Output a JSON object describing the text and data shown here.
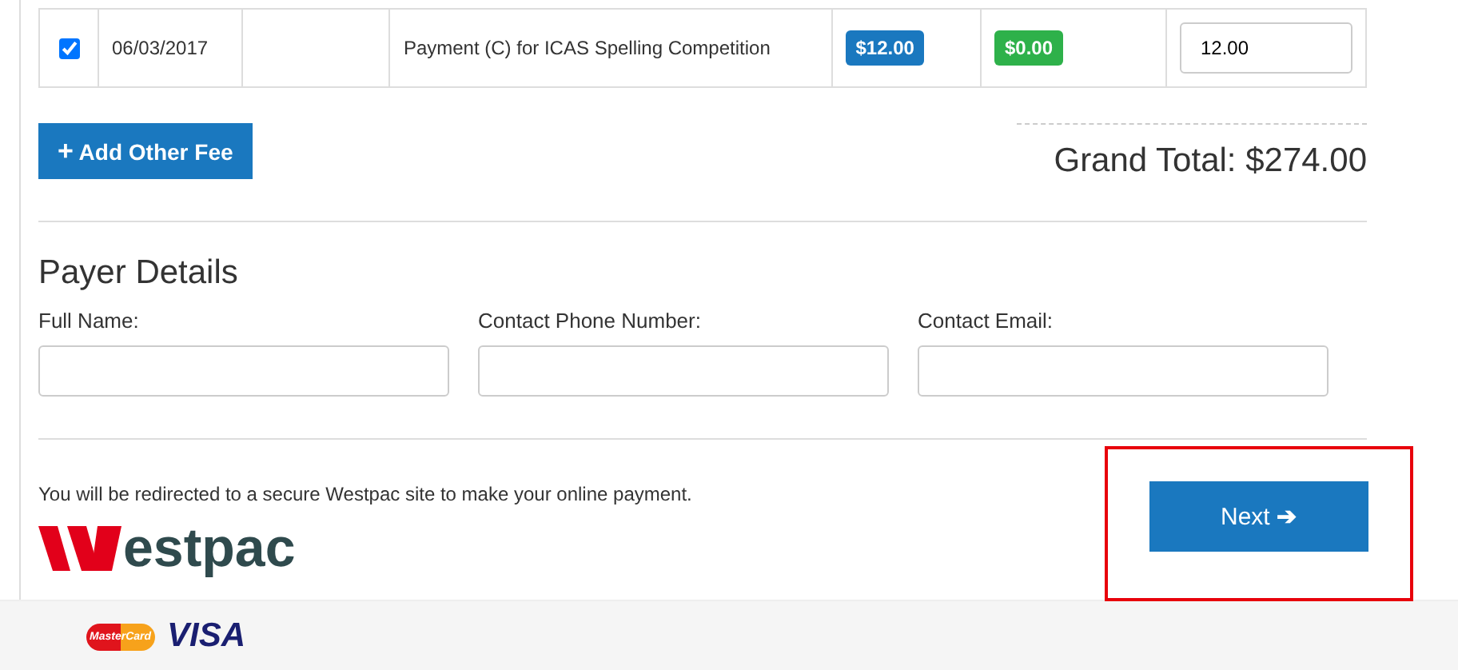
{
  "fee_rows": [
    {
      "checked": true,
      "date": "06/03/2017",
      "description": "Payment (C) for ICAS Spelling Competition",
      "amount_badge": "$12.00",
      "paid_badge": "$0.00",
      "amount_value": "12.00"
    }
  ],
  "add_fee_button": {
    "icon": "+",
    "label": "Add Other Fee"
  },
  "grand_total": "Grand Total: $274.00",
  "payer_details": {
    "heading": "Payer Details",
    "fields": [
      {
        "label": "Full Name:"
      },
      {
        "label": "Contact Phone Number:"
      },
      {
        "label": "Contact Email:"
      }
    ]
  },
  "redirect_notice": "You will be redirected to a secure Westpac site to make your online payment.",
  "next_button": {
    "label": "Next",
    "icon": "➔",
    "highlighted": true
  },
  "westpac_logo": {
    "text": "estpac"
  },
  "card_logos": {
    "mastercard": "MasterCard",
    "visa": "VISA"
  }
}
